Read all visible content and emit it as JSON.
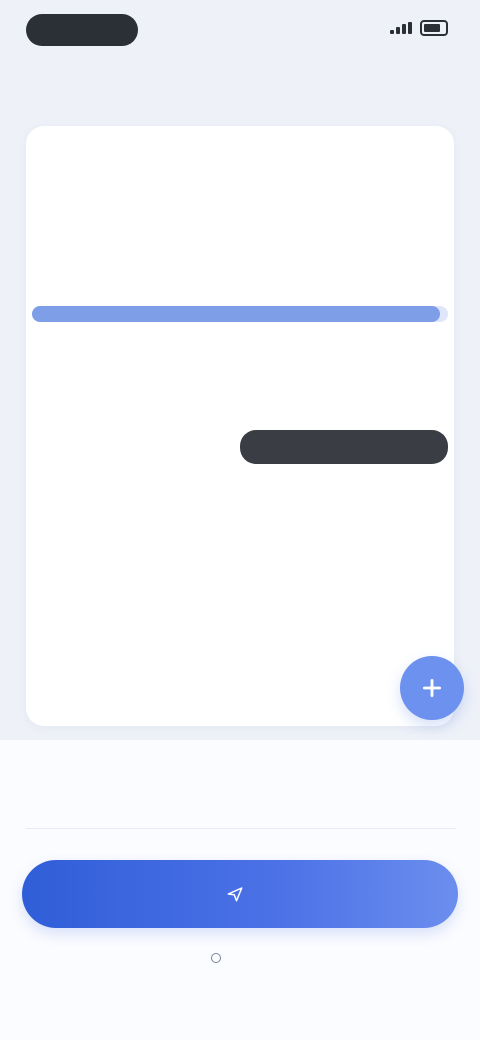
{
  "status_bar": {
    "time": "",
    "signal_icon": "signal-icon",
    "battery_icon": "battery-icon"
  },
  "nav": {
    "title": "",
    "action": ""
  },
  "transfer": {
    "from_label": "",
    "from_name": "",
    "to_label": "",
    "to_name": "",
    "progress_fraction": 0.98
  },
  "chat": {
    "meta": "",
    "bubble_text": ""
  },
  "fab": {
    "icon": "plus-icon",
    "accent": "#6d91ee"
  },
  "footer": {
    "total_label": "",
    "total_value": "",
    "primary_button_label": "",
    "primary_icon": "send-icon",
    "tabs": [
      "",
      "",
      ""
    ]
  },
  "colors": {
    "background": "#eef1f8",
    "primary": "#2f5ed8",
    "progress": "#7e9ee8"
  }
}
